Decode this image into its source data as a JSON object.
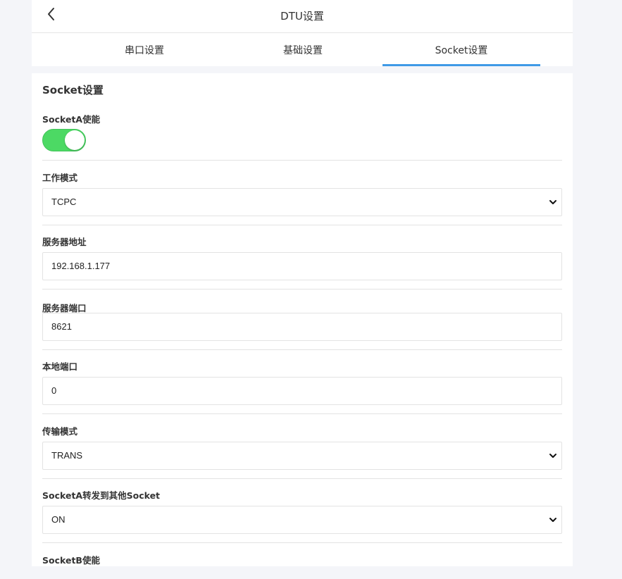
{
  "nav": {
    "title": "DTU设置",
    "back_icon": "chevron-left-icon"
  },
  "tabs": [
    {
      "label": "串口设置",
      "active": false
    },
    {
      "label": "基础设置",
      "active": false
    },
    {
      "label": "Socket设置",
      "active": true
    }
  ],
  "colors": {
    "accent": "#3f9ae6",
    "toggle_on": "#4cd964",
    "page_bg": "#f4f5f9"
  },
  "section": {
    "title": "Socket设置"
  },
  "fields": {
    "socketa_enable": {
      "label": "SocketA使能",
      "value": true
    },
    "work_mode": {
      "label": "工作模式",
      "value": "TCPC"
    },
    "server_address": {
      "label": "服务器地址",
      "value": "192.168.1.177"
    },
    "server_port": {
      "label": "服务器端口",
      "value": "8621"
    },
    "local_port": {
      "label": "本地端口",
      "value": "0"
    },
    "transfer_mode": {
      "label": "传输模式",
      "value": "TRANS"
    },
    "socketa_forward": {
      "label": "SocketA转发到其他Socket",
      "value": "ON"
    },
    "socketb_enable": {
      "label": "SocketB使能"
    }
  }
}
